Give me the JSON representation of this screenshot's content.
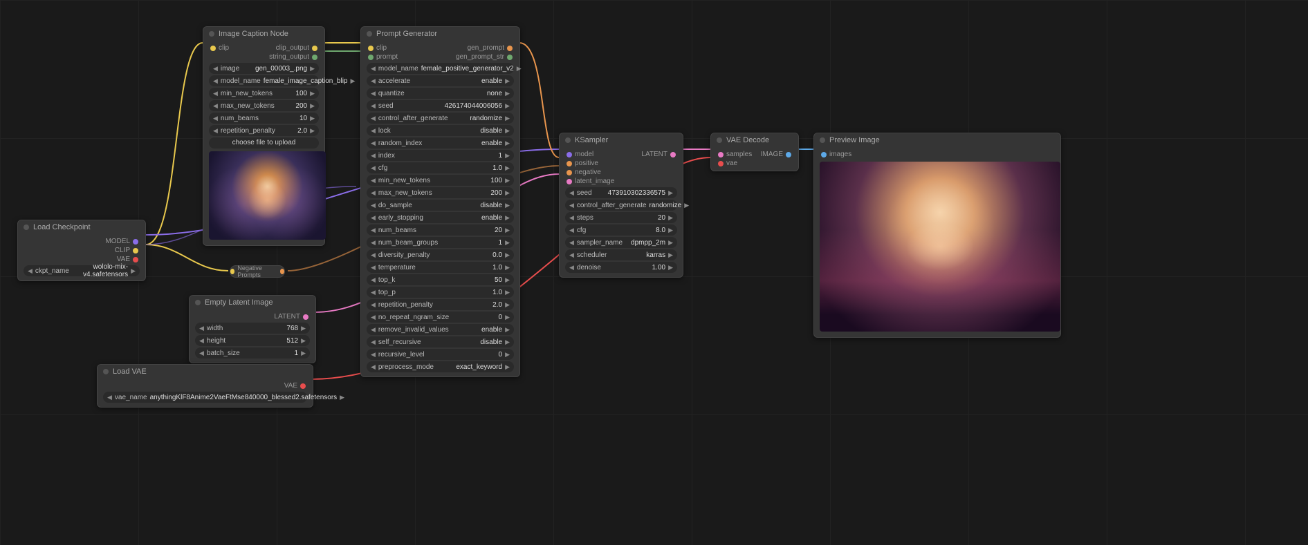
{
  "loadCheckpoint": {
    "title": "Load Checkpoint",
    "outputs": [
      "MODEL",
      "CLIP",
      "VAE"
    ],
    "ckpt_name_label": "ckpt_name",
    "ckpt_name": "wololo-mix-v4.safetensors"
  },
  "imageCaption": {
    "title": "Image Caption Node",
    "inputs": [
      "clip"
    ],
    "outputs": [
      "clip_output",
      "string_output"
    ],
    "params": [
      {
        "label": "image",
        "value": "gen_00003_.png"
      },
      {
        "label": "model_name",
        "value": "female_image_caption_blip"
      },
      {
        "label": "min_new_tokens",
        "value": "100"
      },
      {
        "label": "max_new_tokens",
        "value": "200"
      },
      {
        "label": "num_beams",
        "value": "10"
      },
      {
        "label": "repetition_penalty",
        "value": "2.0"
      }
    ],
    "upload_label": "choose file to upload"
  },
  "promptGenerator": {
    "title": "Prompt Generator",
    "inputs": [
      "clip",
      "prompt"
    ],
    "outputs": [
      "gen_prompt",
      "gen_prompt_str"
    ],
    "params": [
      {
        "label": "model_name",
        "value": "female_positive_generator_v2"
      },
      {
        "label": "accelerate",
        "value": "enable"
      },
      {
        "label": "quantize",
        "value": "none"
      },
      {
        "label": "seed",
        "value": "426174044006056"
      },
      {
        "label": "control_after_generate",
        "value": "randomize"
      },
      {
        "label": "lock",
        "value": "disable"
      },
      {
        "label": "random_index",
        "value": "enable"
      },
      {
        "label": "index",
        "value": "1"
      },
      {
        "label": "cfg",
        "value": "1.0"
      },
      {
        "label": "min_new_tokens",
        "value": "100"
      },
      {
        "label": "max_new_tokens",
        "value": "200"
      },
      {
        "label": "do_sample",
        "value": "disable"
      },
      {
        "label": "early_stopping",
        "value": "enable"
      },
      {
        "label": "num_beams",
        "value": "20"
      },
      {
        "label": "num_beam_groups",
        "value": "1"
      },
      {
        "label": "diversity_penalty",
        "value": "0.0"
      },
      {
        "label": "temperature",
        "value": "1.0"
      },
      {
        "label": "top_k",
        "value": "50"
      },
      {
        "label": "top_p",
        "value": "1.0"
      },
      {
        "label": "repetition_penalty",
        "value": "2.0"
      },
      {
        "label": "no_repeat_ngram_size",
        "value": "0"
      },
      {
        "label": "remove_invalid_values",
        "value": "enable"
      },
      {
        "label": "self_recursive",
        "value": "disable"
      },
      {
        "label": "recursive_level",
        "value": "0"
      },
      {
        "label": "preprocess_mode",
        "value": "exact_keyword"
      }
    ]
  },
  "negativePrompts": {
    "title": "Negative Prompts"
  },
  "emptyLatent": {
    "title": "Empty Latent Image",
    "outputs": [
      "LATENT"
    ],
    "params": [
      {
        "label": "width",
        "value": "768"
      },
      {
        "label": "height",
        "value": "512"
      },
      {
        "label": "batch_size",
        "value": "1"
      }
    ]
  },
  "loadVAE": {
    "title": "Load VAE",
    "outputs": [
      "VAE"
    ],
    "vae_name_label": "vae_name",
    "vae_name": "anythingKlF8Anime2VaeFtMse840000_blessed2.safetensors"
  },
  "ksampler": {
    "title": "KSampler",
    "inputs": [
      "model",
      "positive",
      "negative",
      "latent_image"
    ],
    "outputs": [
      "LATENT"
    ],
    "params": [
      {
        "label": "seed",
        "value": "473910302336575"
      },
      {
        "label": "control_after_generate",
        "value": "randomize"
      },
      {
        "label": "steps",
        "value": "20"
      },
      {
        "label": "cfg",
        "value": "8.0"
      },
      {
        "label": "sampler_name",
        "value": "dpmpp_2m"
      },
      {
        "label": "scheduler",
        "value": "karras"
      },
      {
        "label": "denoise",
        "value": "1.00"
      }
    ]
  },
  "vaeDecode": {
    "title": "VAE Decode",
    "inputs": [
      "samples",
      "vae"
    ],
    "outputs": [
      "IMAGE"
    ]
  },
  "previewImage": {
    "title": "Preview Image",
    "inputs": [
      "images"
    ]
  }
}
